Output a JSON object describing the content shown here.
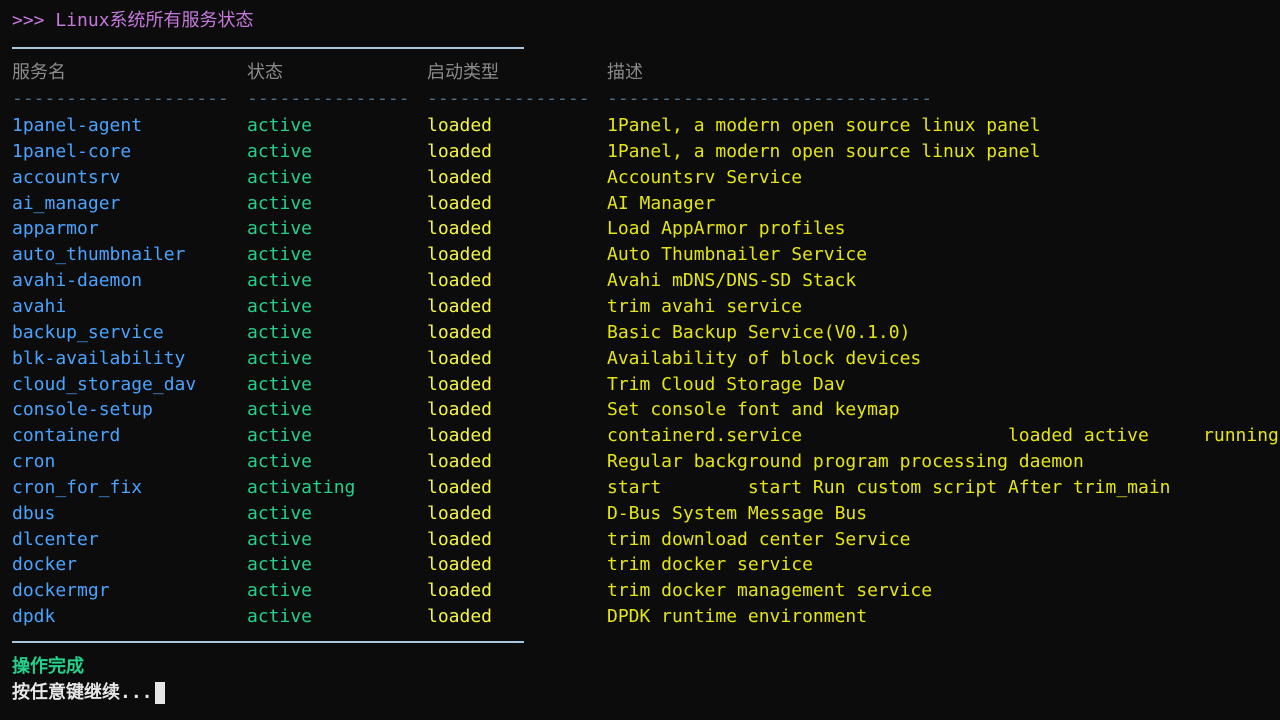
{
  "title": ">>> Linux系统所有服务状态",
  "headers": {
    "name": "服务名",
    "status": "状态",
    "type": "启动类型",
    "desc": "描述"
  },
  "dashes": {
    "name": "--------------------",
    "status": "---------------",
    "type": "---------------",
    "desc": "------------------------------"
  },
  "rows": [
    {
      "name": "1panel-agent",
      "status": "active",
      "type": "loaded",
      "desc": "1Panel, a modern open source linux panel"
    },
    {
      "name": "1panel-core",
      "status": "active",
      "type": "loaded",
      "desc": "1Panel, a modern open source linux panel"
    },
    {
      "name": "accountsrv",
      "status": "active",
      "type": "loaded",
      "desc": "Accountsrv Service"
    },
    {
      "name": "ai_manager",
      "status": "active",
      "type": "loaded",
      "desc": "AI Manager"
    },
    {
      "name": "apparmor",
      "status": "active",
      "type": "loaded",
      "desc": "Load AppArmor profiles"
    },
    {
      "name": "auto_thumbnailer",
      "status": "active",
      "type": "loaded",
      "desc": "Auto Thumbnailer Service"
    },
    {
      "name": "avahi-daemon",
      "status": "active",
      "type": "loaded",
      "desc": "Avahi mDNS/DNS-SD Stack"
    },
    {
      "name": "avahi",
      "status": "active",
      "type": "loaded",
      "desc": "trim avahi service"
    },
    {
      "name": "backup_service",
      "status": "active",
      "type": "loaded",
      "desc": "Basic Backup Service(V0.1.0)"
    },
    {
      "name": "blk-availability",
      "status": "active",
      "type": "loaded",
      "desc": "Availability of block devices"
    },
    {
      "name": "cloud_storage_dav",
      "status": "active",
      "type": "loaded",
      "desc": "Trim Cloud Storage Dav"
    },
    {
      "name": "console-setup",
      "status": "active",
      "type": "loaded",
      "desc": "Set console font and keymap"
    },
    {
      "name": "containerd",
      "status": "active",
      "type": "loaded",
      "desc": "containerd.service                   loaded active     running"
    },
    {
      "name": "cron",
      "status": "active",
      "type": "loaded",
      "desc": "Regular background program processing daemon"
    },
    {
      "name": "cron_for_fix",
      "status": "activating",
      "type": "loaded",
      "desc": "start        start Run custom script After trim_main"
    },
    {
      "name": "dbus",
      "status": "active",
      "type": "loaded",
      "desc": "D-Bus System Message Bus"
    },
    {
      "name": "dlcenter",
      "status": "active",
      "type": "loaded",
      "desc": "trim download center Service"
    },
    {
      "name": "docker",
      "status": "active",
      "type": "loaded",
      "desc": "trim docker service"
    },
    {
      "name": "dockermgr",
      "status": "active",
      "type": "loaded",
      "desc": "trim docker management service"
    },
    {
      "name": "dpdk",
      "status": "active",
      "type": "loaded",
      "desc": "DPDK runtime environment"
    }
  ],
  "footer": {
    "done": "操作完成",
    "prompt": "按任意键继续..."
  },
  "colors": {
    "title": "#c678dd",
    "name": "#4aa3ff",
    "status": "#23d18b",
    "type": "#f5f543",
    "desc": "#e5e510",
    "done": "#23d18b"
  }
}
